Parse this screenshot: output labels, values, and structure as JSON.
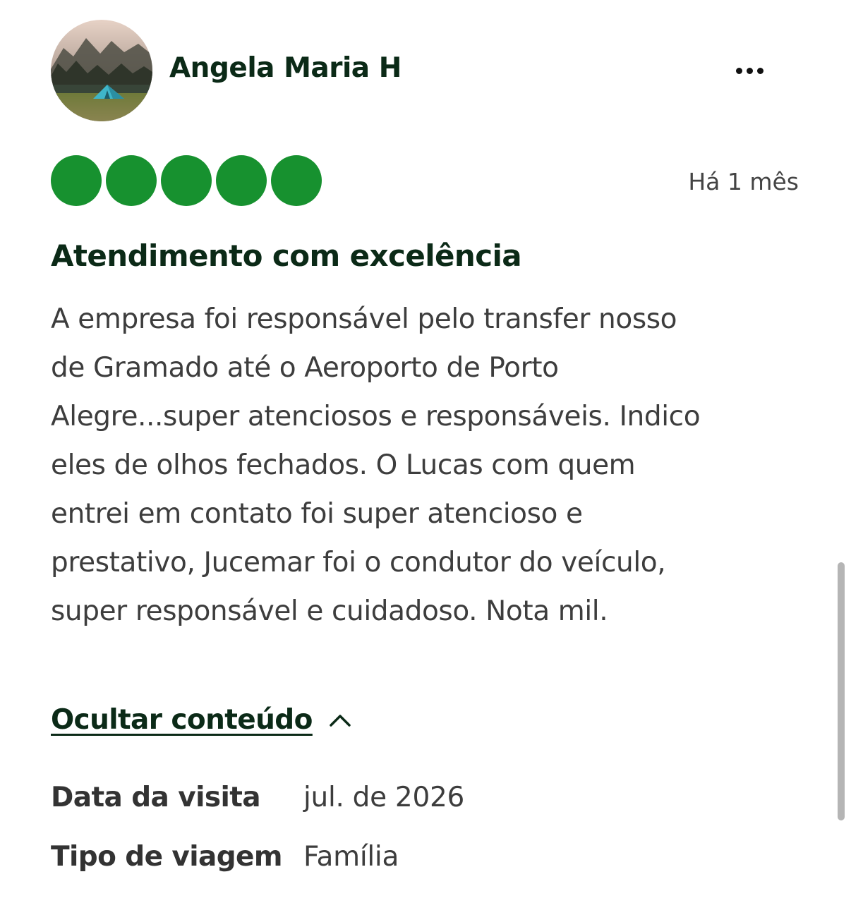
{
  "reviewer": {
    "name": "Angela Maria H",
    "avatar_icon": "camping-tent-photo"
  },
  "actions": {
    "more_icon": "more-horizontal-icon"
  },
  "rating": {
    "value": 5,
    "max": 5,
    "color": "#17912f"
  },
  "review": {
    "date": "Há 1 mês",
    "title": "Atendimento com excelência",
    "body_lines": [
      "A empresa foi responsável pelo transfer nosso",
      "de Gramado até o Aeroporto de Porto",
      "Alegre...super atenciosos e responsáveis. Indico",
      "eles de olhos fechados. O Lucas com quem",
      "entrei em contato foi super atencioso e",
      "prestativo, Jucemar foi o condutor do veículo,",
      "super responsável e cuidadoso. Nota mil."
    ]
  },
  "toggle": {
    "label": "Ocultar conteúdo",
    "icon": "chevron-up-icon"
  },
  "details": [
    {
      "label": "Data da visita",
      "value": "jul. de 2026"
    },
    {
      "label": "Tipo de viagem",
      "value": "Família"
    }
  ],
  "colors": {
    "title_green": "#0b2a17",
    "bubble_green": "#17912f"
  }
}
